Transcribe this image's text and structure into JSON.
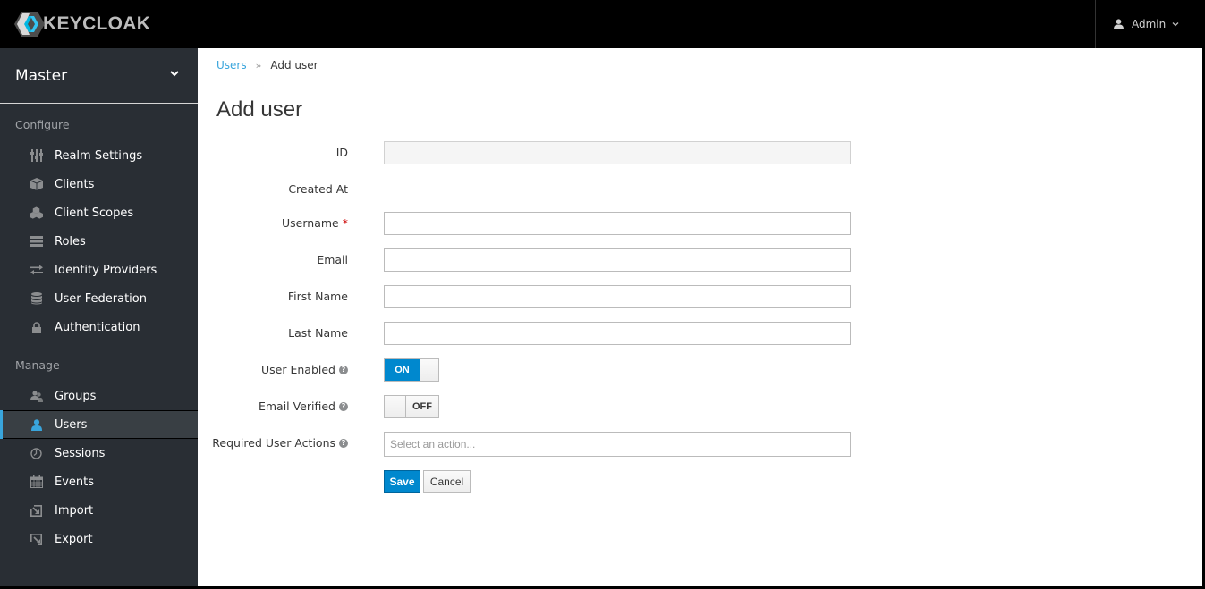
{
  "app": {
    "brand": "KEYCLOAK",
    "user_menu": {
      "label": "Admin",
      "icon": "user-icon",
      "chevron": "chevron-down-icon"
    }
  },
  "colors": {
    "accent": "#0088ce",
    "link": "#39a5dc",
    "navbar_bg": "#000000",
    "sidebar_bg": "#292e34",
    "active_item_bg": "#393f44",
    "required": "#cc0000"
  },
  "sidebar": {
    "realm": "Master",
    "sections": [
      {
        "title": "Configure",
        "items": [
          {
            "label": "Realm Settings",
            "icon": "sliders-icon"
          },
          {
            "label": "Clients",
            "icon": "cube-icon"
          },
          {
            "label": "Client Scopes",
            "icon": "cubes-icon"
          },
          {
            "label": "Roles",
            "icon": "server-icon"
          },
          {
            "label": "Identity Providers",
            "icon": "exchange-icon"
          },
          {
            "label": "User Federation",
            "icon": "database-icon"
          },
          {
            "label": "Authentication",
            "icon": "lock-icon"
          }
        ]
      },
      {
        "title": "Manage",
        "items": [
          {
            "label": "Groups",
            "icon": "users-icon"
          },
          {
            "label": "Users",
            "icon": "user-icon",
            "active": true
          },
          {
            "label": "Sessions",
            "icon": "clock-icon"
          },
          {
            "label": "Events",
            "icon": "calendar-icon"
          },
          {
            "label": "Import",
            "icon": "import-icon"
          },
          {
            "label": "Export",
            "icon": "export-icon"
          }
        ]
      }
    ]
  },
  "breadcrumb": {
    "parent": "Users",
    "separator": "»",
    "current": "Add user"
  },
  "page": {
    "title": "Add user"
  },
  "form": {
    "id": {
      "label": "ID",
      "value": ""
    },
    "created_at": {
      "label": "Created At",
      "value": ""
    },
    "username": {
      "label": "Username",
      "required_mark": "*",
      "value": ""
    },
    "email": {
      "label": "Email",
      "value": ""
    },
    "first_name": {
      "label": "First Name",
      "value": ""
    },
    "last_name": {
      "label": "Last Name",
      "value": ""
    },
    "user_enabled": {
      "label": "User Enabled",
      "state": "ON",
      "on": true
    },
    "email_verified": {
      "label": "Email Verified",
      "state": "OFF",
      "on": false
    },
    "required_actions": {
      "label": "Required User Actions",
      "placeholder": "Select an action..."
    },
    "help_glyph": "?",
    "save_label": "Save",
    "cancel_label": "Cancel"
  }
}
